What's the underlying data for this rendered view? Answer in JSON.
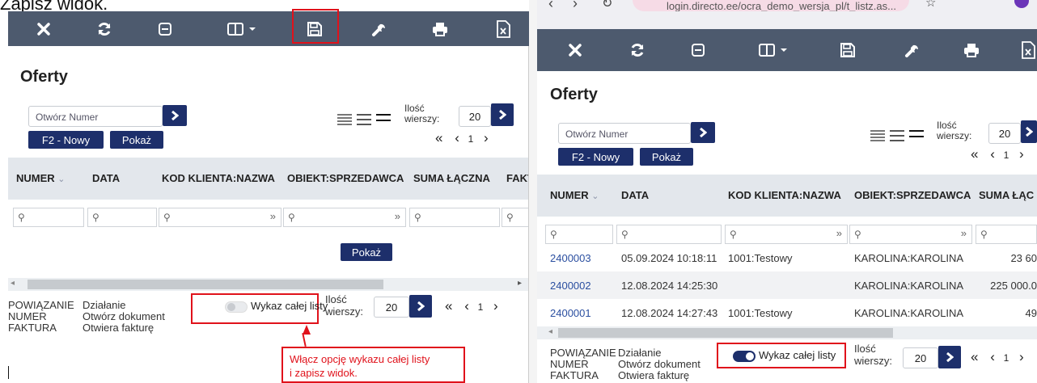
{
  "caption": "Zapisz widok.",
  "browser": {
    "url": "login.directo.ee/ocra_demo_wersja_pl/t_listz.as..."
  },
  "toolbar": {
    "icons": [
      "close-icon",
      "refresh-icon",
      "minimize-icon",
      "columns-icon",
      "save-icon",
      "wrench-icon",
      "print-icon",
      "excel-icon"
    ]
  },
  "page": {
    "title": "Oferty",
    "search_placeholder": "Otwórz Numer",
    "new_button": "F2 - Nowy",
    "show_button": "Pokaż",
    "rows_label_1": "Ilość",
    "rows_label_2": "wierszy:",
    "rows_value": "20",
    "pager_first": "«",
    "pager_prev": "‹",
    "pager_page": "1",
    "pager_next": "›"
  },
  "table": {
    "headers": [
      "NUMER",
      "DATA",
      "KOD KLIENTA:NAZWA",
      "OBIEKT:SPRZEDAWCA",
      "SUMA ŁĄCZNA",
      "FAKT"
    ],
    "headers_right": [
      "NUMER",
      "DATA",
      "KOD KLIENTA:NAZWA",
      "OBIEKT:SPRZEDAWCA",
      "SUMA ŁĄC"
    ],
    "show_button": "Pokaż",
    "rows": [
      {
        "numer": "2400003",
        "data": "05.09.2024 10:18:11",
        "klient": "1001:Testowy",
        "obiekt": "KAROLINA:KAROLINA",
        "suma": "23 60"
      },
      {
        "numer": "2400002",
        "data": "12.08.2024 14:25:30",
        "klient": "",
        "obiekt": "KAROLINA:KAROLINA",
        "suma": "225 000.0"
      },
      {
        "numer": "2400001",
        "data": "12.08.2024 14:27:43",
        "klient": "1001:Testowy",
        "obiekt": "KAROLINA:KAROLINA",
        "suma": "49"
      }
    ]
  },
  "footer": {
    "col1": [
      "POWIĄZANIE",
      "NUMER",
      "FAKTURA"
    ],
    "col2": [
      "Działanie",
      "Otwórz dokument",
      "Otwiera fakturę"
    ],
    "toggle_label": "Wykaz całej listy",
    "rows_label_1": "Ilość",
    "rows_label_2": "wierszy:",
    "rows_value": "20"
  },
  "callout": {
    "line1": "Włącz opcję wykazu całej listy",
    "line2": "i zapisz widok."
  },
  "colors": {
    "accent_red": "#e0121b",
    "navy": "#1d2f6b",
    "toolbar": "#4d5a6e"
  }
}
